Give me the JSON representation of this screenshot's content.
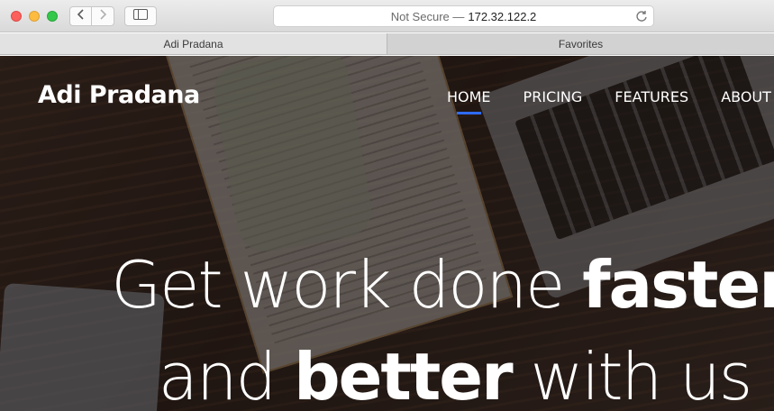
{
  "browser": {
    "url_security": "Not Secure —",
    "url_host": "172.32.122.2",
    "tabs": [
      "Adi Pradana",
      "Favorites"
    ]
  },
  "site": {
    "brand": "Adi Pradana",
    "nav": [
      "HOME",
      "PRICING",
      "FEATURES",
      "ABOUT"
    ],
    "hero": {
      "line1_light": "Get work done ",
      "line1_bold": "faster",
      "line2_light_a": "and ",
      "line2_bold": "better",
      "line2_light_b": " with us"
    }
  },
  "colors": {
    "accent": "#2f6bff",
    "text_light": "#ffffff"
  },
  "icons": [
    "back-icon",
    "forward-icon",
    "sidebar-icon",
    "reload-icon"
  ]
}
